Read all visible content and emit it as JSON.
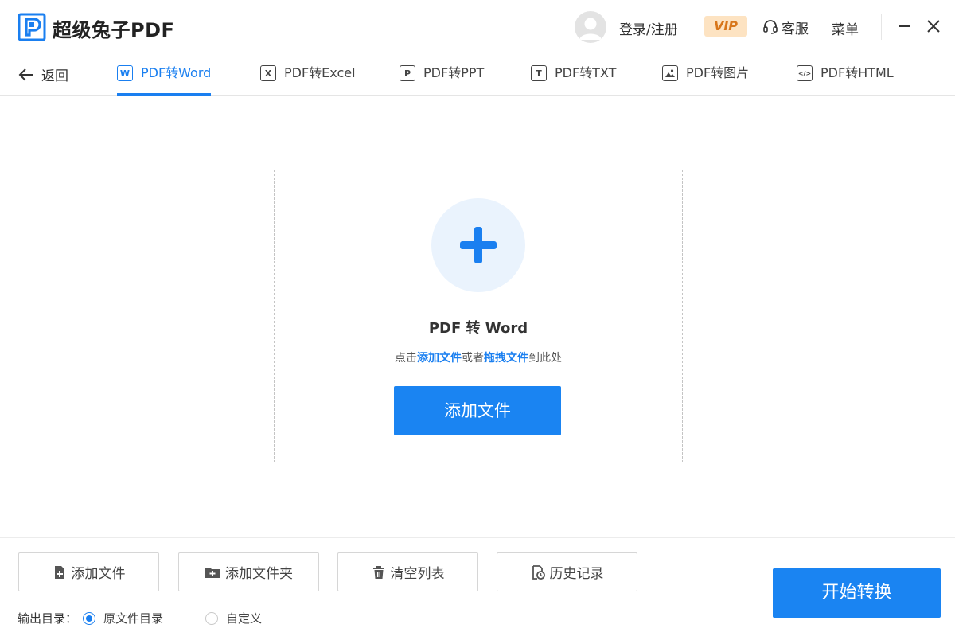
{
  "app": {
    "title": "超级兔子PDF"
  },
  "header": {
    "login_label": "登录/注册",
    "vip_label": "VIP",
    "service_label": "客服",
    "menu_label": "菜单"
  },
  "nav": {
    "back_label": "返回",
    "tabs": [
      {
        "label": "PDF转Word",
        "icon_glyph": "W",
        "icon": "word-icon",
        "active": true
      },
      {
        "label": "PDF转Excel",
        "icon_glyph": "X",
        "icon": "excel-icon",
        "active": false
      },
      {
        "label": "PDF转PPT",
        "icon_glyph": "P",
        "icon": "ppt-icon",
        "active": false
      },
      {
        "label": "PDF转TXT",
        "icon_glyph": "T",
        "icon": "txt-icon",
        "active": false
      },
      {
        "label": "PDF转图片",
        "icon_glyph": "",
        "icon": "image-icon",
        "active": false
      },
      {
        "label": "PDF转HTML",
        "icon_glyph": "</>",
        "icon": "html-icon",
        "active": false
      }
    ]
  },
  "dropzone": {
    "title": "PDF 转 Word",
    "hint_prefix": "点击",
    "hint_link1": "添加文件",
    "hint_middle": "或者",
    "hint_link2": "拖拽文件",
    "hint_suffix": "到此处",
    "button_label": "添加文件"
  },
  "toolbar": {
    "add_file": "添加文件",
    "add_folder": "添加文件夹",
    "clear_list": "清空列表",
    "history": "历史记录"
  },
  "output": {
    "label": "输出目录：",
    "options": [
      {
        "label": "原文件目录",
        "checked": true
      },
      {
        "label": "自定义",
        "checked": false
      }
    ]
  },
  "start_button": "开始转换",
  "colors": {
    "accent": "#1a84f2",
    "vip_bg": "#fde3c2",
    "vip_text": "#d8761a"
  }
}
